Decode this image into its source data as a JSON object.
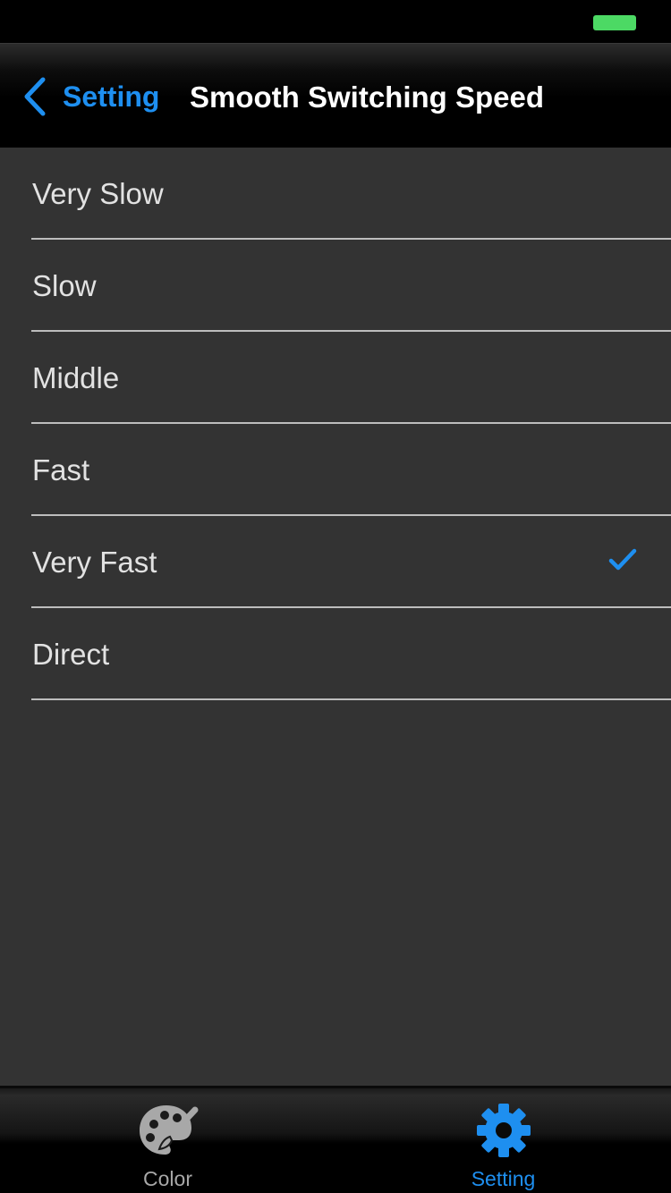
{
  "status_bar": {
    "battery_color": "#4cd964",
    "battery_icon": "battery-icon"
  },
  "nav": {
    "back_label": "Setting",
    "back_icon": "chevron-left-icon",
    "title": "Smooth Switching Speed",
    "accent_color": "#1e8ff0"
  },
  "options": [
    {
      "label": "Very Slow",
      "selected": false
    },
    {
      "label": "Slow",
      "selected": false
    },
    {
      "label": "Middle",
      "selected": false
    },
    {
      "label": "Fast",
      "selected": false
    },
    {
      "label": "Very Fast",
      "selected": true
    },
    {
      "label": "Direct",
      "selected": false
    }
  ],
  "check_icon": "checkmark-icon",
  "tabs": [
    {
      "label": "Color",
      "icon": "palette-icon",
      "active": false,
      "color": "#a8a8a8"
    },
    {
      "label": "Setting",
      "icon": "gear-icon",
      "active": true,
      "color": "#1e8ff0"
    }
  ]
}
